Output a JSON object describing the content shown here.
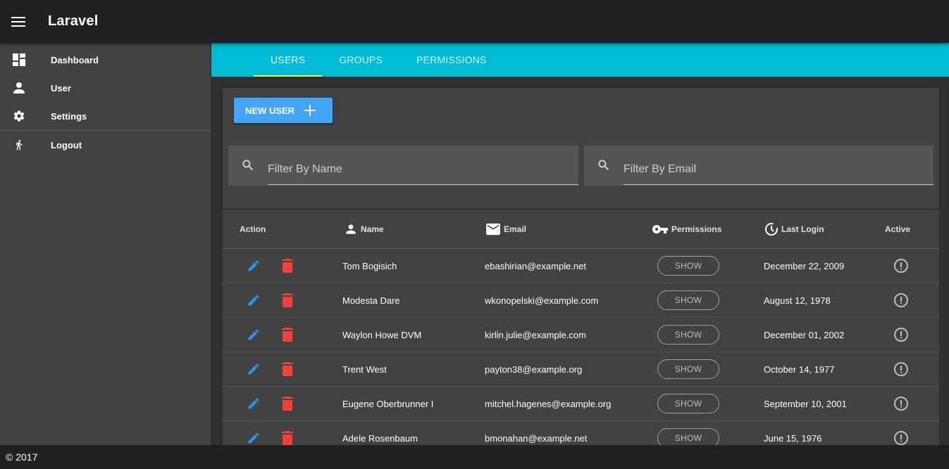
{
  "app": {
    "title": "Laravel"
  },
  "sidebar": {
    "items": [
      {
        "label": "Dashboard",
        "icon": "dashboard-icon"
      },
      {
        "label": "User",
        "icon": "person-icon"
      },
      {
        "label": "Settings",
        "icon": "gear-icon"
      },
      {
        "label": "Logout",
        "icon": "walk-icon"
      }
    ]
  },
  "tabs": [
    {
      "label": "USERS",
      "active": true
    },
    {
      "label": "GROUPS",
      "active": false
    },
    {
      "label": "PERMISSIONS",
      "active": false
    }
  ],
  "toolbar": {
    "new_user_label": "NEW USER"
  },
  "filters": {
    "name_placeholder": "Filter By Name",
    "email_placeholder": "Filter By Email"
  },
  "table": {
    "headers": {
      "action": "Action",
      "name": "Name",
      "email": "Email",
      "permissions": "Permissions",
      "last_login": "Last Login",
      "active": "Active"
    },
    "show_label": "SHOW",
    "rows": [
      {
        "name": "Tom Bogisich",
        "email": "ebashirian@example.net",
        "last_login": "December 22, 2009"
      },
      {
        "name": "Modesta Dare",
        "email": "wkonopelski@example.com",
        "last_login": "August 12, 1978"
      },
      {
        "name": "Waylon Howe DVM",
        "email": "kirlin.julie@example.com",
        "last_login": "December 01, 2002"
      },
      {
        "name": "Trent West",
        "email": "payton38@example.org",
        "last_login": "October 14, 1977"
      },
      {
        "name": "Eugene Oberbrunner I",
        "email": "mitchel.hagenes@example.org",
        "last_login": "September 10, 2001"
      },
      {
        "name": "Adele Rosenbaum",
        "email": "bmonahan@example.net",
        "last_login": "June 15, 1976"
      }
    ]
  },
  "colors": {
    "accent": "#00bcd4",
    "tab_indicator": "#ffeb3b",
    "primary_button": "#42a5f5",
    "edit_icon": "#2196f3",
    "delete_icon": "#f44336"
  },
  "footer": {
    "text": "© 2017"
  }
}
